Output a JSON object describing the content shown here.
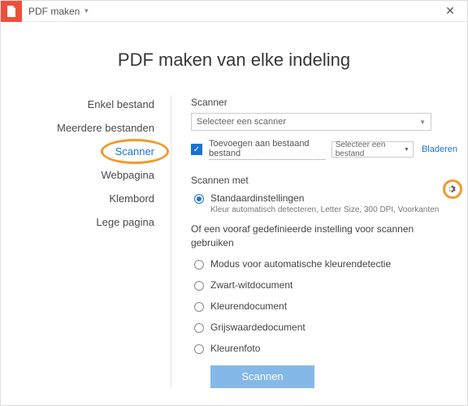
{
  "titlebar": {
    "title": "PDF maken"
  },
  "heading": "PDF maken van elke indeling",
  "sidebar": {
    "items": [
      {
        "label": "Enkel bestand"
      },
      {
        "label": "Meerdere bestanden"
      },
      {
        "label": "Scanner"
      },
      {
        "label": "Webpagina"
      },
      {
        "label": "Klembord"
      },
      {
        "label": "Lege pagina"
      }
    ]
  },
  "panel": {
    "scanner_label": "Scanner",
    "scanner_placeholder": "Selecteer een scanner",
    "append_label": "Toevoegen aan bestaand bestand",
    "file_select_placeholder": "Selecteer een bestand",
    "browse": "Bladeren",
    "scan_with": "Scannen met",
    "default_option": {
      "label": "Standaardinstellingen",
      "desc": "Kleur automatisch detecteren, Letter Size, 300 DPI, Voorkanten"
    },
    "predefined_text": "Of een vooraf gedefinieerde instelling voor scannen gebruiken",
    "presets": [
      {
        "label": "Modus voor automatische kleurendetectie"
      },
      {
        "label": "Zwart-witdocument"
      },
      {
        "label": "Kleurendocument"
      },
      {
        "label": "Grijswaardedocument"
      },
      {
        "label": "Kleurenfoto"
      }
    ],
    "scan_button": "Scannen"
  }
}
